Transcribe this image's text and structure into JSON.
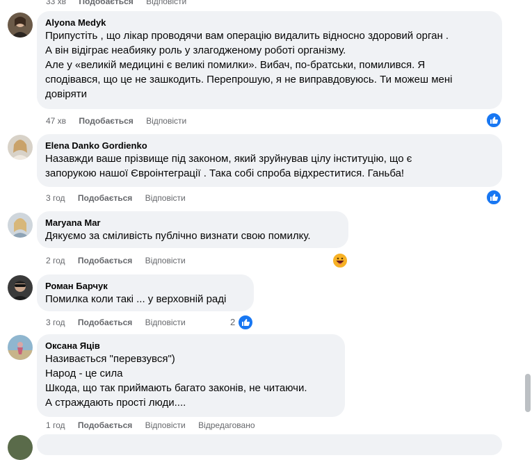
{
  "top_meta": {
    "time": "33 хв",
    "like": "Подобається",
    "reply": "Відповісти"
  },
  "comments": [
    {
      "author": "Alyona Medyk",
      "text": "Припустіть , що лікар проводячи вам операцію видалить відносно здоровий орган .\nА він відіграє неабияку роль у злагодженому роботі організму.\nАле у «великій медицині є великі помилки». Вибач, по-братськи, помилився. Я\nсподівався, що це не зашкодить. Перепрошую, я не виправдовуюсь. Ти можеш мені\nдовіряти",
      "time": "47 хв",
      "like": "Подобається",
      "reply": "Відповісти",
      "reaction": "like-icon"
    },
    {
      "author": "Elena Danko Gordienko",
      "text": "Назавжди ваше прізвище під законом, який зруйнував цілу інституцію, що є\nзапорукою нашої Євроінтеграції . Така собі спроба відхреститися. Ганьба!",
      "time": "3 год",
      "like": "Подобається",
      "reply": "Відповісти",
      "reaction": "like-icon"
    },
    {
      "author": "Maryana Mar",
      "text": "Дякуємо за сміливість публічно визнати свою помилку.",
      "time": "2 год",
      "like": "Подобається",
      "reply": "Відповісти",
      "reaction": "haha-icon"
    },
    {
      "author": "Роман Барчук",
      "text": "Помилка коли такі ... у верховній раді",
      "time": "3 год",
      "like": "Подобається",
      "reply": "Відповісти",
      "reaction": "like-icon",
      "reaction_count": "2"
    },
    {
      "author": "Оксана Яців",
      "text": "Називається \"перевзувся\")\nНарод - це сила\nШкода, що так приймають багато законів, не читаючи.\nА страждають прості люди....",
      "time": "1 год",
      "like": "Подобається",
      "reply": "Відповісти",
      "edited": "Відредаговано"
    }
  ],
  "colors": {
    "bubble": "#f0f2f5",
    "meta": "#65676b",
    "like": "#1877f2",
    "haha": "#f7b125"
  }
}
